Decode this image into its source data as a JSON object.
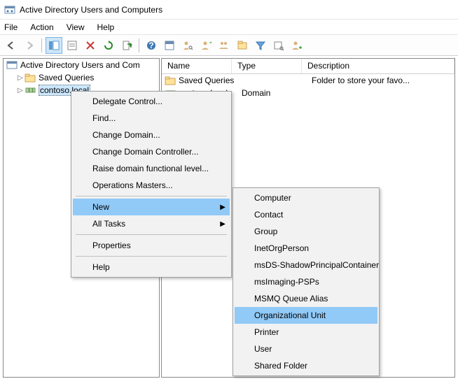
{
  "title": "Active Directory Users and Computers",
  "menubar": {
    "file": "File",
    "action": "Action",
    "view": "View",
    "help": "Help"
  },
  "tree": {
    "root": "Active Directory Users and Com",
    "saved_queries": "Saved Queries",
    "domain": "contoso.local"
  },
  "columns": {
    "name": "Name",
    "type": "Type",
    "desc": "Description"
  },
  "rows": [
    {
      "name": "Saved Queries",
      "type": "",
      "desc": "Folder to store your favo..."
    },
    {
      "name": "contoso.local",
      "type": "Domain",
      "desc": ""
    }
  ],
  "ctx1": {
    "delegate": "Delegate Control...",
    "find": "Find...",
    "chgdom": "Change Domain...",
    "chgdc": "Change Domain Controller...",
    "raise": "Raise domain functional level...",
    "ops": "Operations Masters...",
    "new": "New",
    "alltasks": "All Tasks",
    "properties": "Properties",
    "help": "Help"
  },
  "ctx2": {
    "computer": "Computer",
    "contact": "Contact",
    "group": "Group",
    "inetorg": "InetOrgPerson",
    "msds": "msDS-ShadowPrincipalContainer",
    "msimg": "msImaging-PSPs",
    "msmq": "MSMQ Queue Alias",
    "ou": "Organizational Unit",
    "printer": "Printer",
    "user": "User",
    "shared": "Shared Folder"
  }
}
